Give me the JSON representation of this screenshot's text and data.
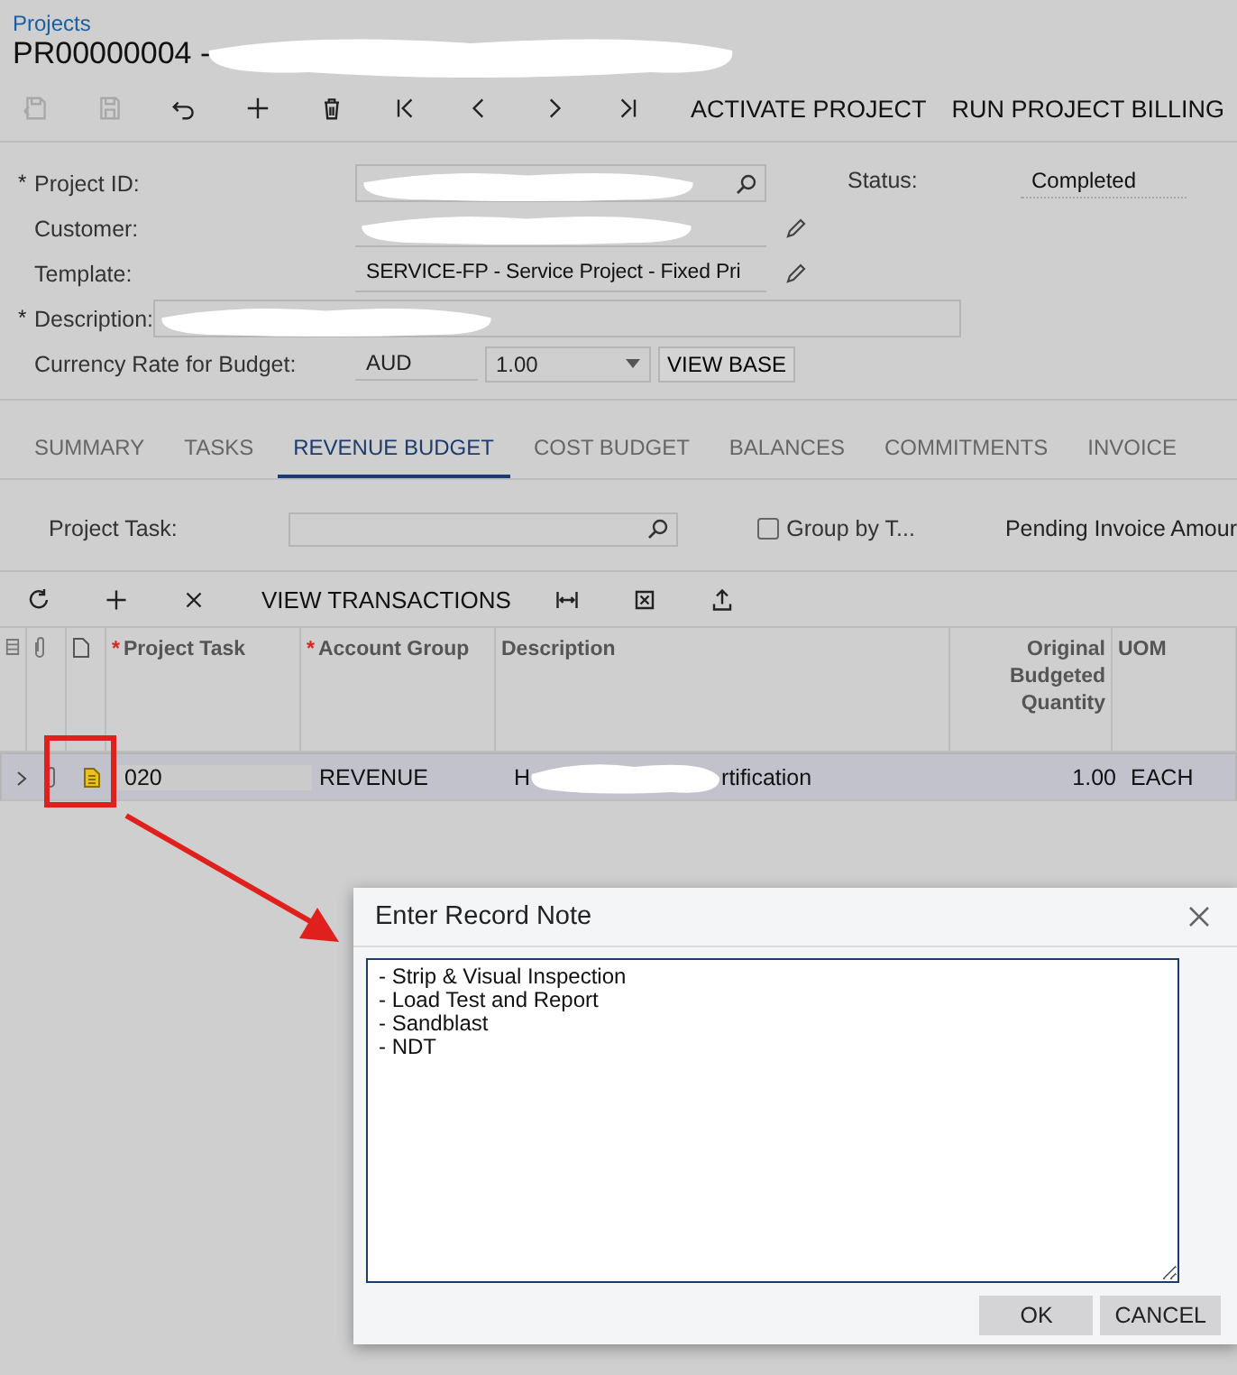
{
  "breadcrumb": "Projects",
  "title": {
    "text": "PR00000004 -",
    "redacted": true
  },
  "toolbar": [
    {
      "kind": "save-cancel",
      "disabled": true
    },
    {
      "kind": "save",
      "disabled": true
    },
    {
      "kind": "undo",
      "disabled": false
    },
    {
      "kind": "add",
      "disabled": false
    },
    {
      "kind": "delete",
      "disabled": false
    },
    {
      "kind": "first",
      "disabled": false
    },
    {
      "kind": "prev",
      "disabled": false
    },
    {
      "kind": "next",
      "disabled": false
    },
    {
      "kind": "last",
      "disabled": false
    },
    {
      "kind": "text",
      "label": "ACTIVATE PROJECT",
      "disabled": false
    },
    {
      "kind": "text",
      "label": "RUN PROJECT BILLING",
      "disabled": false
    }
  ],
  "form": {
    "fields": [
      {
        "label": "Project ID:",
        "marker": "*",
        "kind": "lookup",
        "redacted": true
      },
      {
        "label": "Customer:",
        "kind": "edit",
        "redacted": true
      },
      {
        "label": "Template:",
        "kind": "edit",
        "redacted": false,
        "value": "SERVICE-FP - Service Project - Fixed Pri"
      },
      {
        "label": "Description:",
        "marker": "*",
        "kind": "wide",
        "redacted": true
      },
      {
        "label": "Currency Rate for Budget:",
        "kind": "currency",
        "value": "AUD",
        "select": "1.00",
        "button": "VIEW BASE"
      }
    ],
    "status": {
      "label": "Status:",
      "value": "Completed"
    }
  },
  "tabs": [
    {
      "label": "SUMMARY",
      "selected": false
    },
    {
      "label": "TASKS",
      "selected": false
    },
    {
      "label": "REVENUE BUDGET",
      "selected": true
    },
    {
      "label": "COST BUDGET",
      "selected": false
    },
    {
      "label": "BALANCES",
      "selected": false
    },
    {
      "label": "COMMITMENTS",
      "selected": false
    },
    {
      "label": "INVOICE",
      "selected": false
    }
  ],
  "filter": {
    "label": "Project Task:",
    "checkbox": {
      "label": "Group by T...",
      "checked": false
    },
    "pending": "Pending Invoice Amour"
  },
  "grid_toolbar": [
    {
      "kind": "refresh"
    },
    {
      "kind": "add"
    },
    {
      "kind": "remove"
    },
    {
      "kind": "text",
      "label": "VIEW TRANSACTIONS"
    },
    {
      "kind": "fit"
    },
    {
      "kind": "excel"
    },
    {
      "kind": "upload"
    }
  ],
  "grid": {
    "columns": [
      {
        "kind": "icon-files"
      },
      {
        "kind": "icon-attach"
      },
      {
        "kind": "icon-note"
      },
      {
        "kind": "text",
        "label": "Project Task",
        "marker": "*"
      },
      {
        "kind": "text",
        "label": "Account Group",
        "marker": "*"
      },
      {
        "kind": "text",
        "label": "Description"
      },
      {
        "kind": "num",
        "label": "Original Budgeted Quantity"
      },
      {
        "kind": "text",
        "label": "UOM"
      }
    ],
    "rows": [
      {
        "selected": true,
        "has_note": true,
        "task": "020",
        "account_group": "REVENUE",
        "description_start": "H",
        "description_end": "rtification",
        "quantity": "1.00",
        "uom": "EACH"
      }
    ]
  },
  "dialog": {
    "title": "Enter Record Note",
    "note": "- Strip & Visual Inspection\n- Load Test and Report\n- Sandblast\n- NDT",
    "buttons": [
      "OK",
      "CANCEL"
    ]
  }
}
